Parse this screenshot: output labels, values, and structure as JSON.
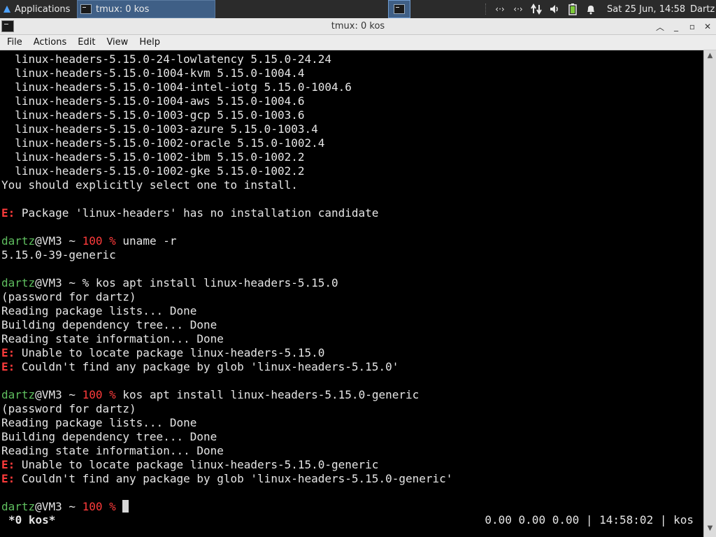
{
  "panel": {
    "apps_label": "Applications",
    "task_label": "tmux: 0 kos",
    "clock": "Sat 25 Jun, 14:58",
    "user": "Dartz",
    "tray": [
      "network-icon",
      "network-icon",
      "network-transfer-icon",
      "volume-icon",
      "battery-icon",
      "notification-bell-icon"
    ]
  },
  "window": {
    "title": "tmux: 0 kos"
  },
  "menu": [
    "File",
    "Actions",
    "Edit",
    "View",
    "Help"
  ],
  "terminal": {
    "lines": [
      [
        {
          "t": "  linux-headers-5.15.0-24-lowlatency 5.15.0-24.24"
        }
      ],
      [
        {
          "t": "  linux-headers-5.15.0-1004-kvm 5.15.0-1004.4"
        }
      ],
      [
        {
          "t": "  linux-headers-5.15.0-1004-intel-iotg 5.15.0-1004.6"
        }
      ],
      [
        {
          "t": "  linux-headers-5.15.0-1004-aws 5.15.0-1004.6"
        }
      ],
      [
        {
          "t": "  linux-headers-5.15.0-1003-gcp 5.15.0-1003.6"
        }
      ],
      [
        {
          "t": "  linux-headers-5.15.0-1003-azure 5.15.0-1003.4"
        }
      ],
      [
        {
          "t": "  linux-headers-5.15.0-1002-oracle 5.15.0-1002.4"
        }
      ],
      [
        {
          "t": "  linux-headers-5.15.0-1002-ibm 5.15.0-1002.2"
        }
      ],
      [
        {
          "t": "  linux-headers-5.15.0-1002-gke 5.15.0-1002.2"
        }
      ],
      [
        {
          "t": "You should explicitly select one to install."
        }
      ],
      [
        {
          "t": ""
        }
      ],
      [
        {
          "t": "E:",
          "c": "err"
        },
        {
          "t": " Package 'linux-headers' has no installation candidate"
        }
      ],
      [
        {
          "t": ""
        }
      ],
      [
        {
          "t": "dartz",
          "c": "user"
        },
        {
          "t": "@VM3 ~ "
        },
        {
          "t": "100 %",
          "c": "code"
        },
        {
          "t": " uname -r"
        }
      ],
      [
        {
          "t": "5.15.0-39-generic"
        }
      ],
      [
        {
          "t": ""
        }
      ],
      [
        {
          "t": "dartz",
          "c": "user"
        },
        {
          "t": "@VM3 ~ % kos apt install linux-headers-5.15.0"
        }
      ],
      [
        {
          "t": "(password for dartz)"
        }
      ],
      [
        {
          "t": "Reading package lists... Done"
        }
      ],
      [
        {
          "t": "Building dependency tree... Done"
        }
      ],
      [
        {
          "t": "Reading state information... Done"
        }
      ],
      [
        {
          "t": "E:",
          "c": "err"
        },
        {
          "t": " Unable to locate package linux-headers-5.15.0"
        }
      ],
      [
        {
          "t": "E:",
          "c": "err"
        },
        {
          "t": " Couldn't find any package by glob 'linux-headers-5.15.0'"
        }
      ],
      [
        {
          "t": ""
        }
      ],
      [
        {
          "t": "dartz",
          "c": "user"
        },
        {
          "t": "@VM3 ~ "
        },
        {
          "t": "100 %",
          "c": "code"
        },
        {
          "t": " kos apt install linux-headers-5.15.0-generic"
        }
      ],
      [
        {
          "t": "(password for dartz)"
        }
      ],
      [
        {
          "t": "Reading package lists... Done"
        }
      ],
      [
        {
          "t": "Building dependency tree... Done"
        }
      ],
      [
        {
          "t": "Reading state information... Done"
        }
      ],
      [
        {
          "t": "E:",
          "c": "err"
        },
        {
          "t": " Unable to locate package linux-headers-5.15.0-generic"
        }
      ],
      [
        {
          "t": "E:",
          "c": "err"
        },
        {
          "t": " Couldn't find any package by glob 'linux-headers-5.15.0-generic'"
        }
      ],
      [
        {
          "t": ""
        }
      ],
      [
        {
          "t": "dartz",
          "c": "user"
        },
        {
          "t": "@VM3 ~ "
        },
        {
          "t": "100 %",
          "c": "code"
        },
        {
          "t": " "
        },
        {
          "t": "",
          "c": "cursor"
        }
      ]
    ],
    "status_left": "*0 kos*",
    "status_right": "0.00 0.00 0.00 | 14:58:02 | kos"
  },
  "colors": {
    "prompt_user": "#5fbf5f",
    "error": "#ff3b3b",
    "terminal_bg": "#000000",
    "terminal_fg": "#e6e6e6"
  }
}
